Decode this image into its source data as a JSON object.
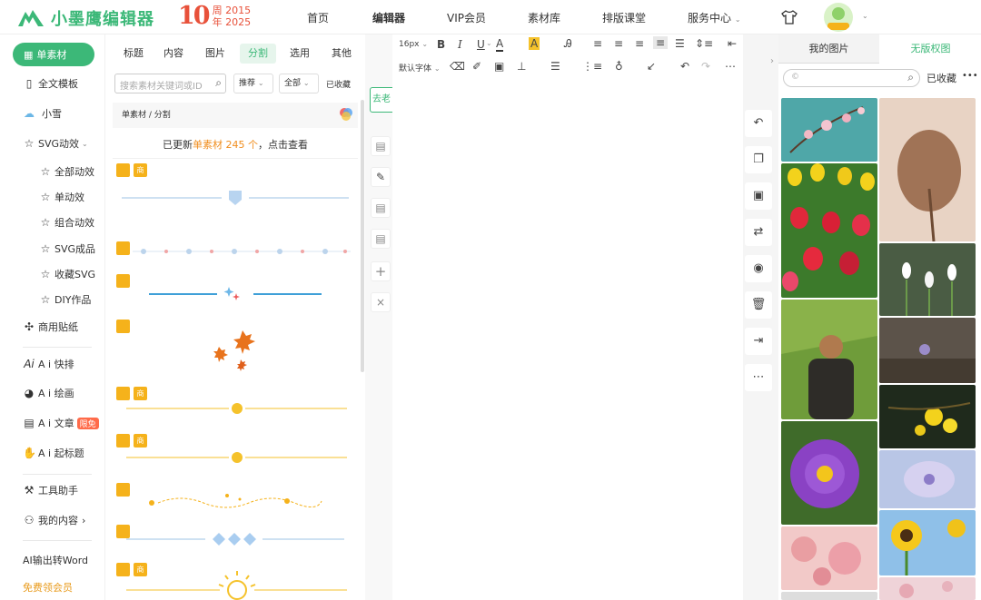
{
  "brand": {
    "name": "小墨鹰编辑器",
    "anniv_num": "10",
    "anniv_line1": "周 2015",
    "anniv_line2": "年 2025"
  },
  "nav": {
    "home": "首页",
    "editor": "编辑器",
    "vip": "VIP会员",
    "materials": "素材库",
    "class": "排版课堂",
    "service": "服务中心"
  },
  "colors": {
    "brand_green": "#3cb878",
    "anniv_red": "#e8513a",
    "accent_orange": "#f08d1d"
  },
  "sidebar": {
    "single_material": "单素材",
    "full_template": "全文模板",
    "xiaoxue": "小雪",
    "svg_anim": "SVG动效",
    "svg_items": [
      "全部动效",
      "单动效",
      "组合动效",
      "SVG成品",
      "收藏SVG",
      "DIY作品"
    ],
    "stickers": "商用贴纸",
    "ai_layout": "A i 快排",
    "ai_draw": "A i 绘画",
    "ai_article": "A i 文章",
    "limited_free": "限免",
    "ai_title": "A i 起标题",
    "tools": "工具助手",
    "my_content": "我的内容",
    "ai_word": "AI输出转Word",
    "free_vip": "免费领会员"
  },
  "panel": {
    "tabs": [
      "标题",
      "内容",
      "图片",
      "分割",
      "选用",
      "其他"
    ],
    "active_tab": "分割",
    "search_placeholder": "搜索素材关键词或ID",
    "filter_recommend": "推荐",
    "filter_all": "全部",
    "collected": "已收藏",
    "breadcrumb": "单素材 / 分割",
    "update_prefix": "已更新",
    "update_highlight": "单素材 245 个",
    "update_suffix": "，点击查看",
    "goto_old": "去老",
    "premium_tag": "商"
  },
  "editor_toolbar": {
    "font_size": "16px",
    "font_family": "默认字体"
  },
  "right_panel": {
    "tab_my_images": "我的图片",
    "tab_free_images": "无版权图",
    "collected": "已收藏",
    "more": "•••"
  }
}
